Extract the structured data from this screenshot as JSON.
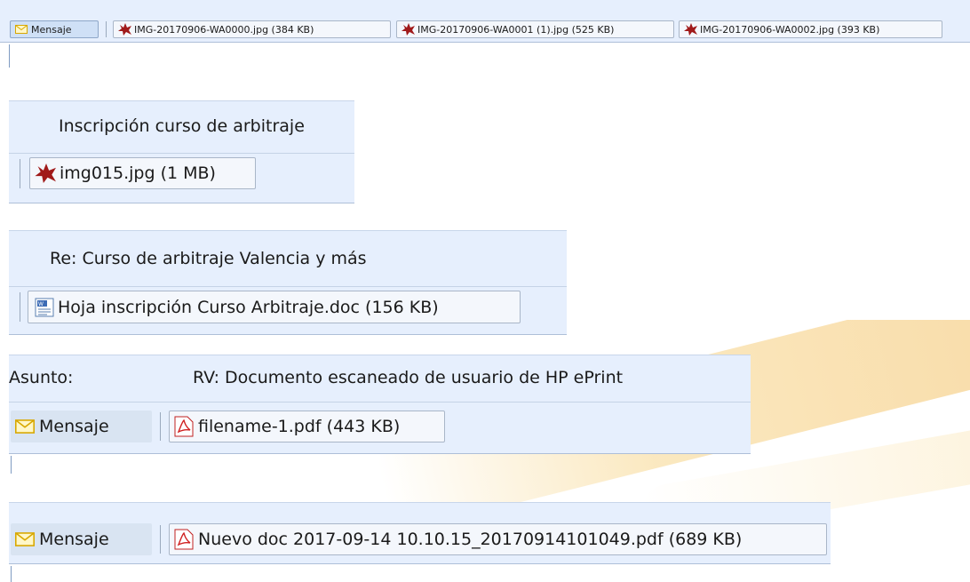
{
  "watermark": {
    "color": "#f4c46e"
  },
  "colors": {
    "panel": "#e6effd",
    "chip_border": "#a9b6c8",
    "message_chip": "#cfe0f6",
    "image_icon": "#a01a1a",
    "pdf_icon": "#d02020",
    "envelope_icon": "#e8b800"
  },
  "strip1": {
    "message_label": "Mensaje",
    "attachments": [
      {
        "label": "IMG-20170906-WA0000.jpg (384 KB)",
        "icon": "image-file-icon"
      },
      {
        "label": "IMG-20170906-WA0001 (1).jpg (525 KB)",
        "icon": "image-file-icon"
      },
      {
        "label": "IMG-20170906-WA0002.jpg (393 KB)",
        "icon": "image-file-icon"
      }
    ]
  },
  "strip2": {
    "subject": "Inscripción curso de arbitraje",
    "attachments": [
      {
        "label": "img015.jpg (1 MB)",
        "icon": "image-file-icon"
      }
    ]
  },
  "strip3": {
    "subject": "Re: Curso de arbitraje Valencia y más",
    "attachments": [
      {
        "label": "Hoja inscripción Curso Arbitraje.doc (156 KB)",
        "icon": "word-doc-icon"
      }
    ]
  },
  "strip4": {
    "subject_label": "Asunto:",
    "subject": "RV: Documento escaneado de usuario de HP ePrint",
    "message_label": "Mensaje",
    "attachments": [
      {
        "label": "filename-1.pdf (443 KB)",
        "icon": "pdf-file-icon"
      }
    ]
  },
  "strip5": {
    "message_label": "Mensaje",
    "attachments": [
      {
        "label": "Nuevo doc 2017-09-14 10.10.15_20170914101049.pdf (689 KB)",
        "icon": "pdf-file-icon"
      }
    ]
  }
}
